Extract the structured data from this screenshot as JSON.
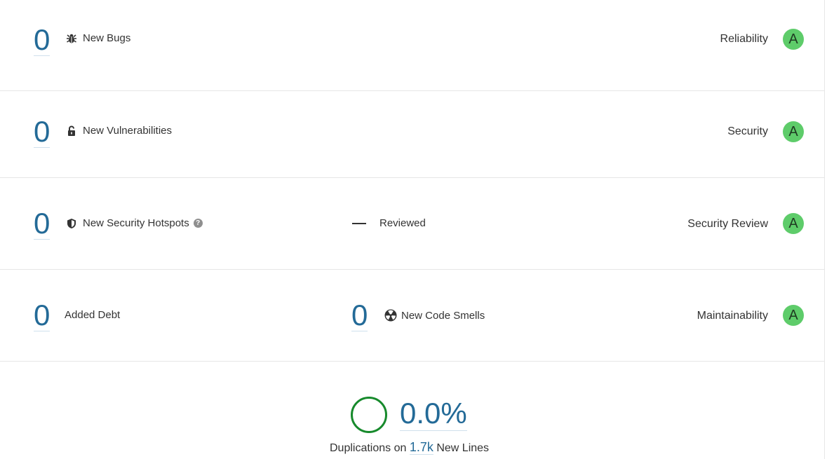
{
  "rows": {
    "bugs": {
      "value": "0",
      "label": "New Bugs",
      "icon": "bug-icon",
      "rating_name": "Reliability",
      "rating": "A"
    },
    "vulnerabilities": {
      "value": "0",
      "label": "New Vulnerabilities",
      "icon": "unlock-icon",
      "rating_name": "Security",
      "rating": "A"
    },
    "hotspots": {
      "value": "0",
      "label": "New Security Hotspots",
      "icon": "shield-icon",
      "help": "?",
      "reviewed_label": "Reviewed",
      "rating_name": "Security Review",
      "rating": "A"
    },
    "maintainability": {
      "debt_value": "0",
      "debt_label": "Added Debt",
      "smells_value": "0",
      "smells_label": "New Code Smells",
      "smells_icon": "code-smell-icon",
      "rating_name": "Maintainability",
      "rating": "A"
    }
  },
  "duplications": {
    "value": "0.0%",
    "caption_prefix": "Duplications on",
    "lines_value": "1.7k",
    "caption_suffix": "New Lines",
    "ring_color": "#178a2c"
  },
  "colors": {
    "link": "#236a97",
    "rating_a": "#5ecc6a",
    "divider": "#e6e6e6"
  }
}
